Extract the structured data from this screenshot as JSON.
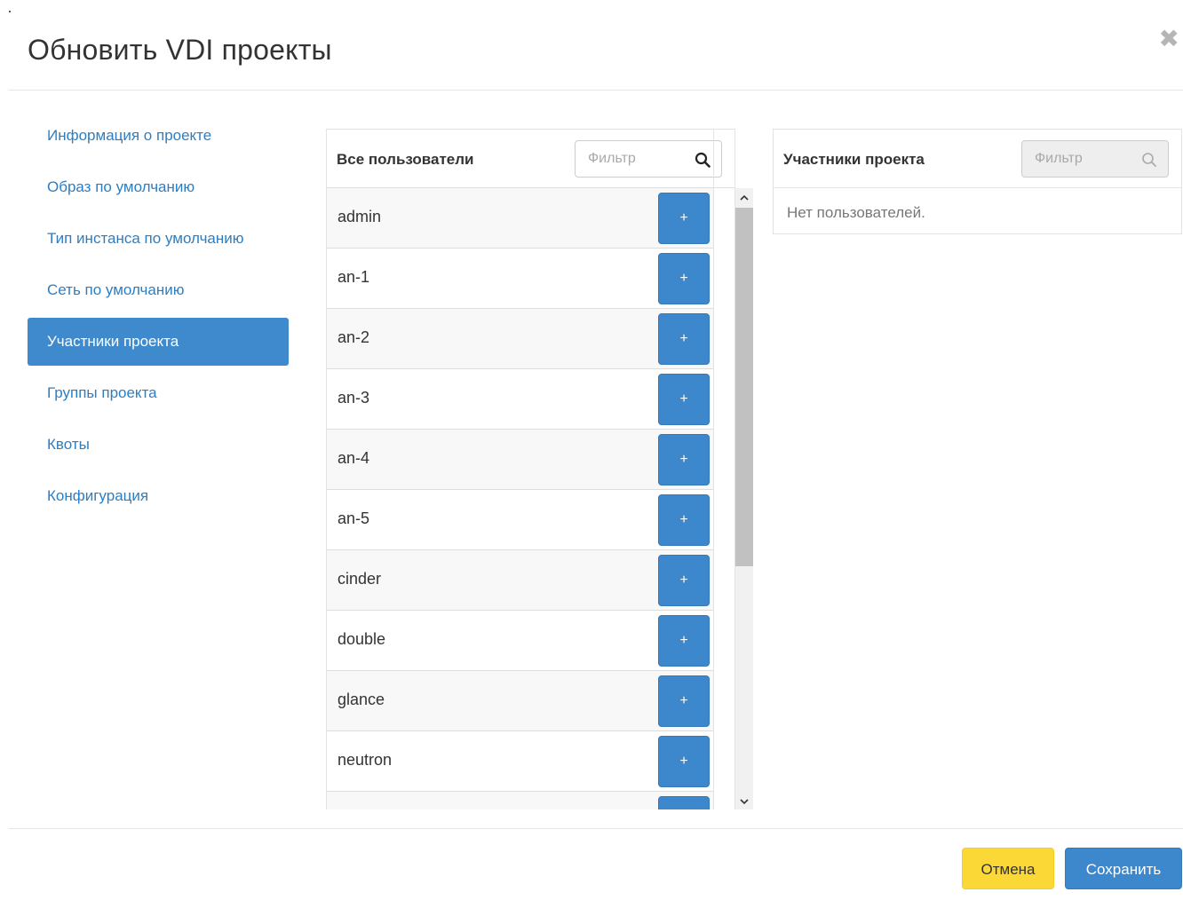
{
  "modal": {
    "title": "Обновить VDI проекты",
    "close_glyph": "✖"
  },
  "nav": {
    "items": [
      {
        "label": "Информация о проекте"
      },
      {
        "label": "Образ по умолчанию"
      },
      {
        "label": "Тип инстанса по умолчанию"
      },
      {
        "label": "Сеть по умолчанию"
      },
      {
        "label": "Участники проекта",
        "active": true
      },
      {
        "label": "Группы проекта"
      },
      {
        "label": "Квоты"
      },
      {
        "label": "Конфигурация"
      }
    ]
  },
  "all_users": {
    "title": "Все пользователи",
    "filter_placeholder": "Фильтр",
    "add_label": "+",
    "users": [
      "admin",
      "an-1",
      "an-2",
      "an-3",
      "an-4",
      "an-5",
      "cinder",
      "double",
      "glance",
      "neutron",
      ""
    ]
  },
  "members": {
    "title": "Участники проекта",
    "filter_placeholder": "Фильтр",
    "empty_text": "Нет пользователей."
  },
  "footer": {
    "cancel_label": "Отмена",
    "save_label": "Сохранить"
  },
  "colors": {
    "primary": "#3d87cc",
    "nav_active": "#3f8acd",
    "link": "#2c7ec3",
    "warning": "#fcd837"
  }
}
